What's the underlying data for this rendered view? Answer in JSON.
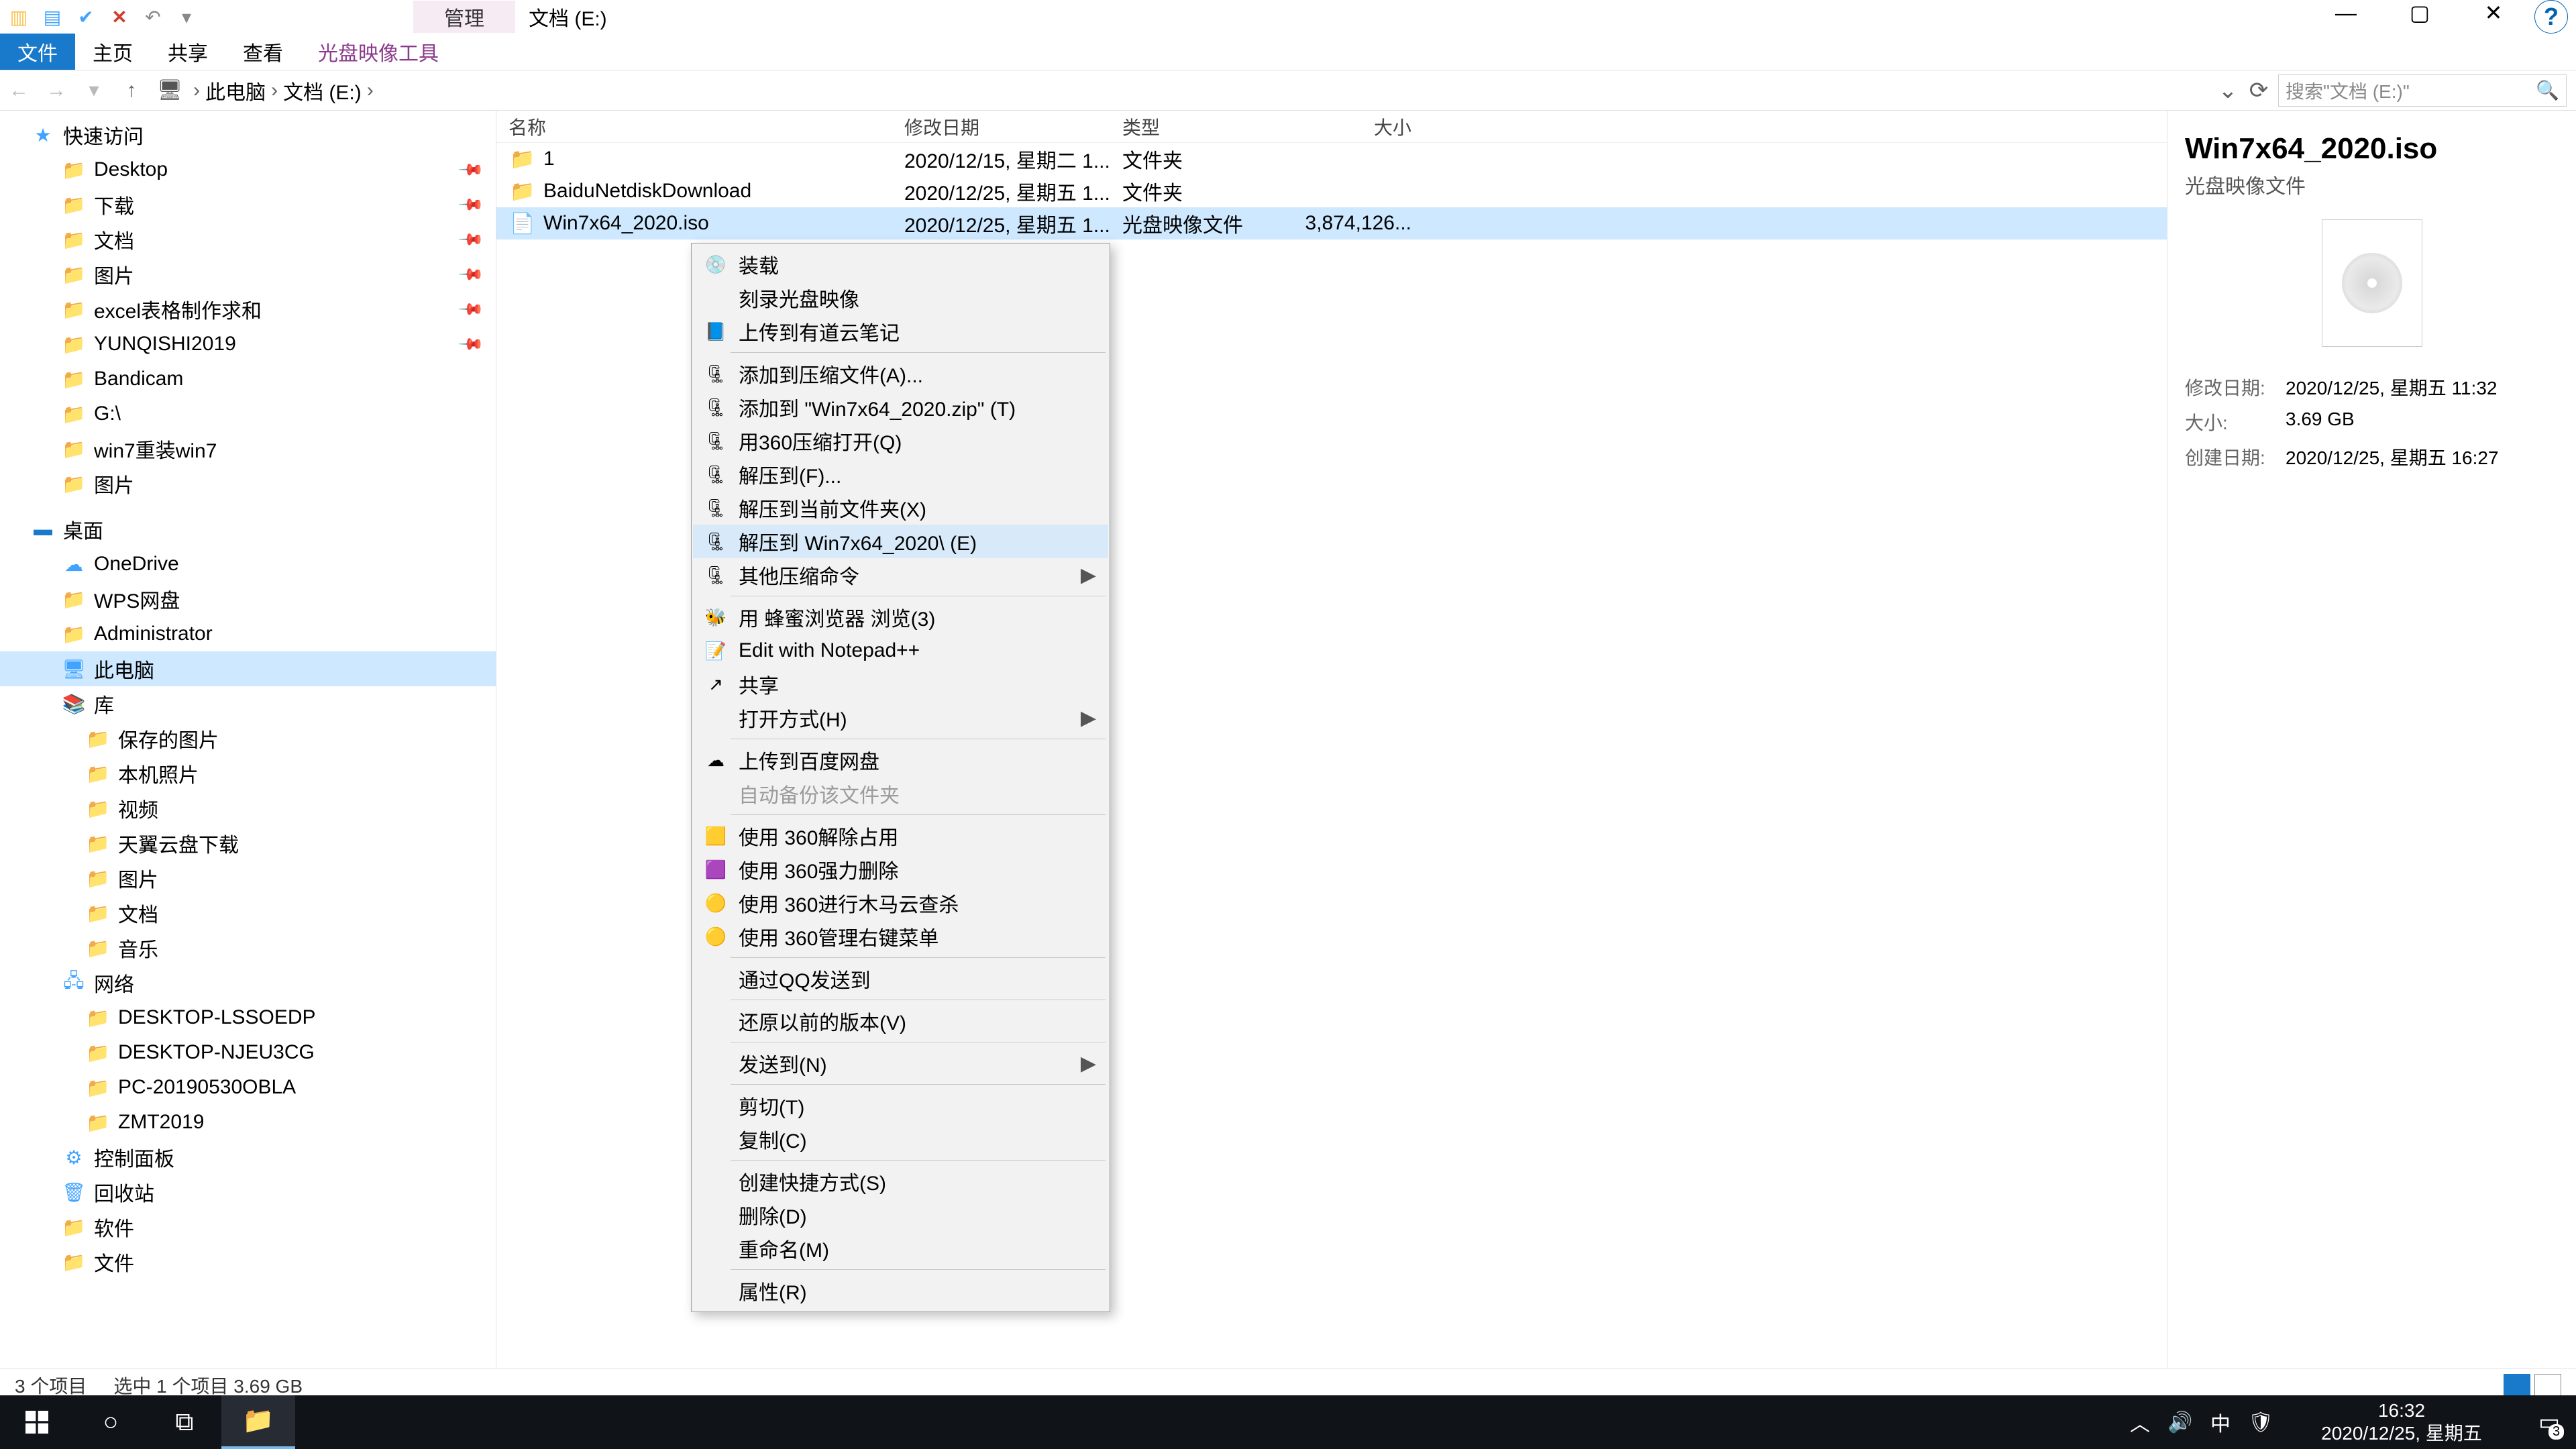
{
  "window": {
    "title": "文档 (E:)",
    "ribbon_extra": "管理"
  },
  "ribbon": {
    "file": "文件",
    "home": "主页",
    "share": "共享",
    "view": "查看",
    "disc_tool": "光盘映像工具"
  },
  "address": {
    "pc": "此电脑",
    "drive": "文档 (E:)"
  },
  "search": {
    "placeholder": "搜索\"文档 (E:)\""
  },
  "tree": {
    "quick": "快速访问",
    "q_items": [
      {
        "label": "Desktop"
      },
      {
        "label": "下载"
      },
      {
        "label": "文档"
      },
      {
        "label": "图片"
      },
      {
        "label": "excel表格制作求和"
      },
      {
        "label": "YUNQISHI2019"
      },
      {
        "label": "Bandicam"
      },
      {
        "label": "G:\\"
      },
      {
        "label": "win7重装win7"
      },
      {
        "label": "图片"
      }
    ],
    "desktop": "桌面",
    "d_items": [
      {
        "label": "OneDrive"
      },
      {
        "label": "WPS网盘"
      },
      {
        "label": "Administrator"
      },
      {
        "label": "此电脑",
        "sel": true
      },
      {
        "label": "库"
      },
      {
        "label": "保存的图片"
      },
      {
        "label": "本机照片"
      },
      {
        "label": "视频"
      },
      {
        "label": "天翼云盘下载"
      },
      {
        "label": "图片"
      },
      {
        "label": "文档"
      },
      {
        "label": "音乐"
      },
      {
        "label": "网络"
      },
      {
        "label": "DESKTOP-LSSOEDP"
      },
      {
        "label": "DESKTOP-NJEU3CG"
      },
      {
        "label": "PC-20190530OBLA"
      },
      {
        "label": "ZMT2019"
      },
      {
        "label": "控制面板"
      },
      {
        "label": "回收站"
      },
      {
        "label": "软件"
      },
      {
        "label": "文件"
      }
    ]
  },
  "columns": {
    "name": "名称",
    "date": "修改日期",
    "type": "类型",
    "size": "大小"
  },
  "rows": [
    {
      "name": "1",
      "date": "2020/12/15, 星期二 1...",
      "type": "文件夹",
      "size": ""
    },
    {
      "name": "BaiduNetdiskDownload",
      "date": "2020/12/25, 星期五 1...",
      "type": "文件夹",
      "size": ""
    },
    {
      "name": "Win7x64_2020.iso",
      "date": "2020/12/25, 星期五 1...",
      "type": "光盘映像文件",
      "size": "3,874,126...",
      "sel": true
    }
  ],
  "details": {
    "title": "Win7x64_2020.iso",
    "subtitle": "光盘映像文件",
    "meta": [
      {
        "k": "修改日期:",
        "v": "2020/12/25, 星期五 11:32"
      },
      {
        "k": "大小:",
        "v": "3.69 GB"
      },
      {
        "k": "创建日期:",
        "v": "2020/12/25, 星期五 16:27"
      }
    ]
  },
  "status": {
    "count": "3 个项目",
    "sel": "选中 1 个项目  3.69 GB"
  },
  "context": [
    {
      "t": "装载",
      "ic": "disc"
    },
    {
      "t": "刻录光盘映像"
    },
    {
      "t": "上传到有道云笔记",
      "ic": "note"
    },
    {
      "sep": true
    },
    {
      "t": "添加到压缩文件(A)...",
      "ic": "zip"
    },
    {
      "t": "添加到 \"Win7x64_2020.zip\" (T)",
      "ic": "zip"
    },
    {
      "t": "用360压缩打开(Q)",
      "ic": "zip"
    },
    {
      "t": "解压到(F)...",
      "ic": "zip"
    },
    {
      "t": "解压到当前文件夹(X)",
      "ic": "zip"
    },
    {
      "t": "解压到 Win7x64_2020\\ (E)",
      "ic": "zip",
      "hover": true
    },
    {
      "t": "其他压缩命令",
      "ic": "zip",
      "arrow": true
    },
    {
      "sep": true
    },
    {
      "t": "用 蜂蜜浏览器 浏览(3)",
      "ic": "bee"
    },
    {
      "t": "Edit with Notepad++",
      "ic": "npp"
    },
    {
      "t": "共享",
      "ic": "share"
    },
    {
      "t": "打开方式(H)",
      "arrow": true
    },
    {
      "sep": true
    },
    {
      "t": "上传到百度网盘",
      "ic": "baidu"
    },
    {
      "t": "自动备份该文件夹",
      "disabled": true
    },
    {
      "sep": true
    },
    {
      "t": "使用 360解除占用",
      "ic": "360y"
    },
    {
      "t": "使用 360强力删除",
      "ic": "360p"
    },
    {
      "t": "使用 360进行木马云查杀",
      "ic": "360g"
    },
    {
      "t": "使用 360管理右键菜单",
      "ic": "360g"
    },
    {
      "sep": true
    },
    {
      "t": "通过QQ发送到"
    },
    {
      "sep": true
    },
    {
      "t": "还原以前的版本(V)"
    },
    {
      "sep": true
    },
    {
      "t": "发送到(N)",
      "arrow": true
    },
    {
      "sep": true
    },
    {
      "t": "剪切(T)"
    },
    {
      "t": "复制(C)"
    },
    {
      "sep": true
    },
    {
      "t": "创建快捷方式(S)"
    },
    {
      "t": "删除(D)"
    },
    {
      "t": "重命名(M)"
    },
    {
      "sep": true
    },
    {
      "t": "属性(R)"
    }
  ],
  "taskbar": {
    "time": "16:32",
    "date": "2020/12/25, 星期五",
    "ime": "中",
    "notif": "3"
  }
}
